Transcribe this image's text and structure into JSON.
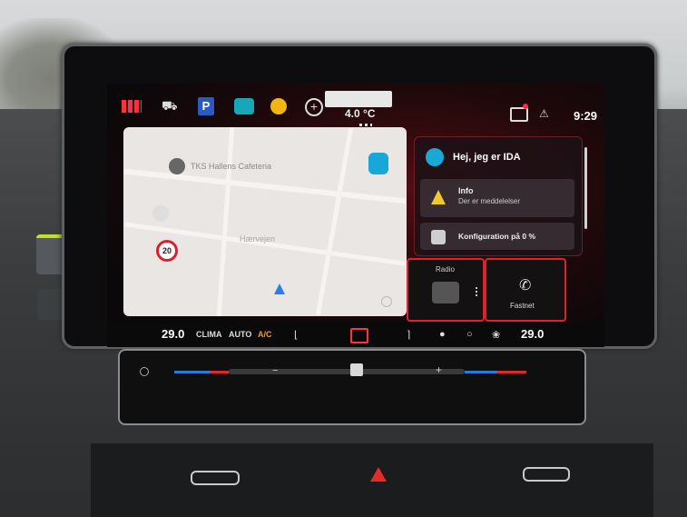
{
  "status_bar": {
    "clock": "9:29",
    "outside_temp": "4.0 °C",
    "parking_label": "P",
    "plus_label": "+"
  },
  "map": {
    "poi_label": "TKS Hallens Cafeteria",
    "street_label": "Hærvejen",
    "speed_limit": "20"
  },
  "assistant": {
    "greeting": "Hej, jeg er IDA",
    "info_title": "Info",
    "info_subtitle": "Der er meddelelser",
    "config_title": "Konfiguration på 0 %"
  },
  "tiles": {
    "radio_label": "Radio",
    "phone_label": "Fastnet"
  },
  "climate": {
    "temp_left": "29.0",
    "temp_right": "29.0",
    "clima_label": "CLIMA",
    "auto_label": "AUTO",
    "ac_label": "A/C"
  },
  "hvac": {
    "minus_label": "−",
    "plus_label": "+"
  },
  "colors": {
    "accent_red": "#e0202e",
    "assistant_blue": "#1aa9d6",
    "ac_orange": "#f29a2e"
  }
}
